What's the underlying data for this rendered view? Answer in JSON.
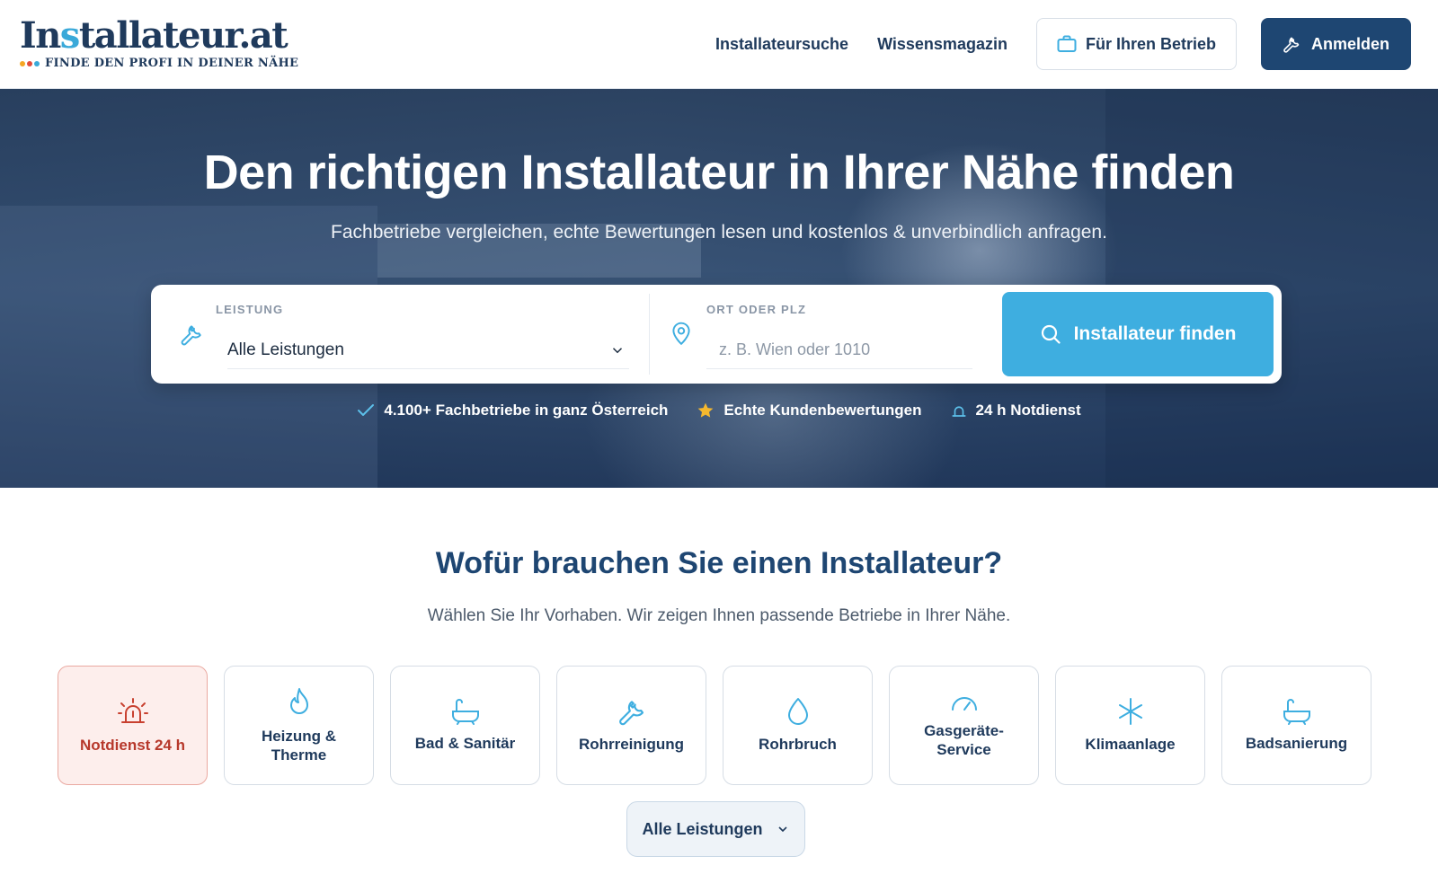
{
  "brand": {
    "name_pre": "In",
    "name_accent": "s",
    "name_post": "tallateur.at",
    "tagline": "FINDE DEN PROFI IN DEINER NÄHE",
    "colors": {
      "navy": "#1e4672",
      "cyan": "#3eaee0",
      "orange": "#f5a623",
      "red": "#e24b3b",
      "blue": "#3aa9d9"
    }
  },
  "nav": {
    "links": [
      "Installateursuche",
      "Wissensmagazin"
    ],
    "business_button": {
      "label": "Für Ihren Betrieb",
      "icon": "briefcase-icon"
    },
    "login_button": {
      "label": "Anmelden",
      "icon": "wrench-icon"
    }
  },
  "hero": {
    "title": "Den richtigen Installateur in Ihrer Nähe finden",
    "subtitle": "Fachbetriebe vergleichen, echte Bewertungen lesen und kostenlos & unverbindlich anfragen.",
    "search": {
      "service_label": "LEISTUNG",
      "service_value": "Alle Leistungen",
      "location_label": "ORT ODER PLZ",
      "location_placeholder": "z. B. Wien oder 1010",
      "location_value": "",
      "button_label": "Installateur finden"
    },
    "trust": [
      {
        "icon": "check-icon",
        "text": "4.100+ Fachbetriebe in ganz Österreich"
      },
      {
        "icon": "star-icon",
        "text": "Echte Kundenbewertungen"
      },
      {
        "icon": "siren-icon",
        "text": "24 h Notdienst"
      }
    ]
  },
  "services": {
    "title": "Wofür brauchen Sie einen Installateur?",
    "subtitle": "Wählen Sie Ihr Vorhaben. Wir zeigen Ihnen passende Betriebe in Ihrer Nähe.",
    "cards": [
      {
        "label": "Notdienst 24 h",
        "icon": "siren-icon"
      },
      {
        "label": "Heizung & Therme",
        "icon": "flame-icon"
      },
      {
        "label": "Bad & Sanitär",
        "icon": "bathtub-icon"
      },
      {
        "label": "Rohrreinigung",
        "icon": "wrench-icon"
      },
      {
        "label": "Rohrbruch",
        "icon": "droplet-icon"
      },
      {
        "label": "Gasgeräte-Service",
        "icon": "gauge-icon"
      },
      {
        "label": "Klimaanlage",
        "icon": "snowflake-icon"
      },
      {
        "label": "Badsanierung",
        "icon": "bathtub-icon"
      }
    ],
    "more_button": "Alle Leistungen"
  }
}
